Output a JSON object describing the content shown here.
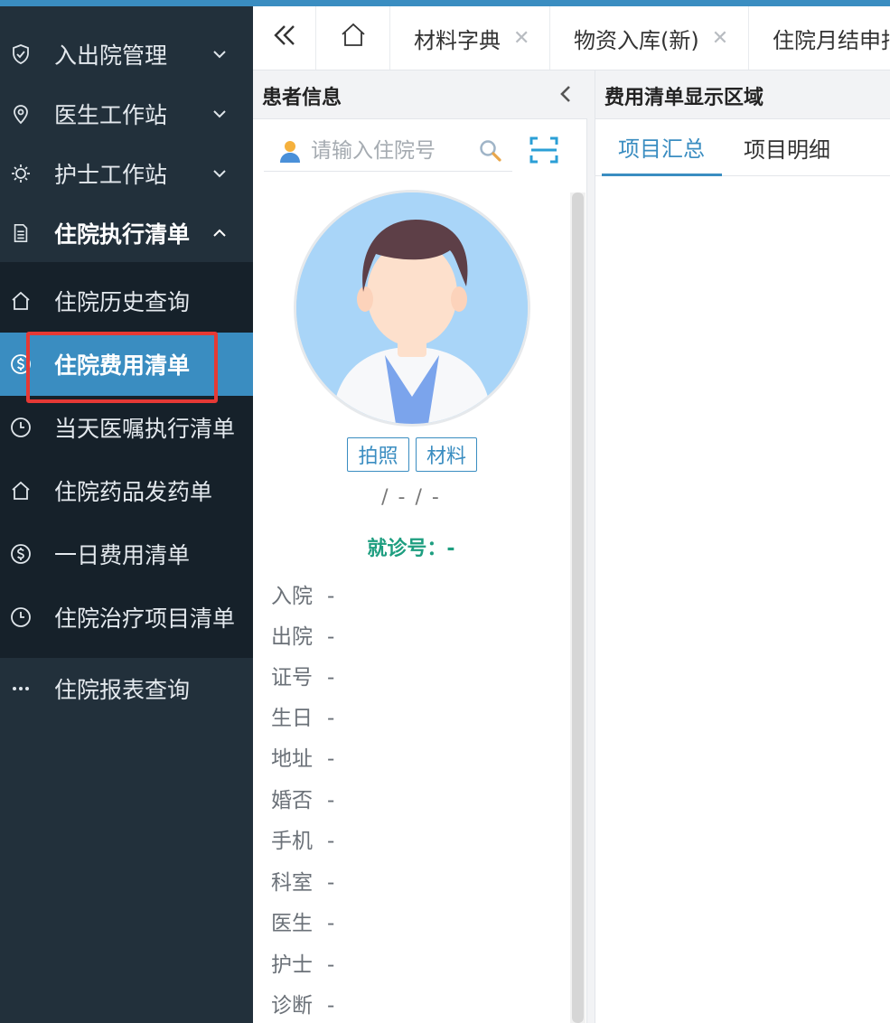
{
  "sidebar": {
    "menu": [
      {
        "label": "入出院管理",
        "icon": "shield-check-icon",
        "expanded": false
      },
      {
        "label": "医生工作站",
        "icon": "location-pin-icon",
        "expanded": false
      },
      {
        "label": "护士工作站",
        "icon": "sun-gear-icon",
        "expanded": false
      },
      {
        "label": "住院执行清单",
        "icon": "document-icon",
        "expanded": true
      }
    ],
    "submenu": [
      {
        "label": "住院历史查询",
        "icon": "home-icon"
      },
      {
        "label": "住院费用清单",
        "icon": "dollar-circle-icon",
        "active": true
      },
      {
        "label": "当天医嘱执行清单",
        "icon": "clock-icon"
      },
      {
        "label": "住院药品发药单",
        "icon": "home-icon"
      },
      {
        "label": "一日费用清单",
        "icon": "dollar-circle-icon"
      },
      {
        "label": "住院治疗项目清单",
        "icon": "clock-icon"
      }
    ],
    "report": {
      "label": "住院报表查询",
      "icon": "more-dots-icon"
    }
  },
  "tabs": {
    "items": [
      {
        "label": "材料字典"
      },
      {
        "label": "物资入库(新)"
      },
      {
        "label": "住院月结申报"
      }
    ]
  },
  "patient": {
    "title": "患者信息",
    "search_placeholder": "请输入住院号",
    "photo_button": "拍照",
    "material_button": "材料",
    "dob_gender_age": "/ - / -",
    "visit_label": "就诊号：-",
    "fields": [
      {
        "label": "入院",
        "value": "-"
      },
      {
        "label": "出院",
        "value": "-"
      },
      {
        "label": "证号",
        "value": "-"
      },
      {
        "label": "生日",
        "value": "-"
      },
      {
        "label": "地址",
        "value": "-"
      },
      {
        "label": "婚否",
        "value": "-"
      },
      {
        "label": "手机",
        "value": "-"
      },
      {
        "label": "科室",
        "value": "-"
      },
      {
        "label": "医生",
        "value": "-"
      },
      {
        "label": "护士",
        "value": "-"
      },
      {
        "label": "诊断",
        "value": "-"
      }
    ]
  },
  "fee": {
    "title": "费用清单显示区域",
    "tabs": [
      {
        "label": "项目汇总",
        "active": true
      },
      {
        "label": "项目明细",
        "active": false
      }
    ]
  },
  "colors": {
    "sidebar_bg": "#22303b",
    "submenu_bg": "#16212a",
    "accent": "#3a8dc1",
    "highlight": "#e53935",
    "visit_green": "#1e9e80"
  }
}
